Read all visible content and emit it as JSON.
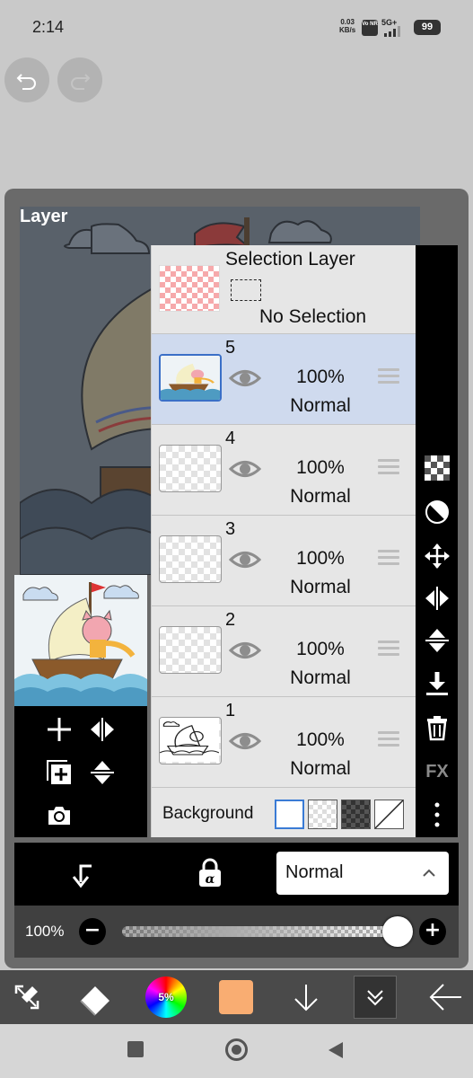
{
  "status_bar": {
    "time": "2:14",
    "net_speed_value": "0.03",
    "net_speed_unit": "KB/s",
    "volte": "Vo NR",
    "signal": "5G+",
    "battery": "99"
  },
  "panel": {
    "title": "Layer"
  },
  "selection_layer": {
    "title": "Selection Layer",
    "status": "No Selection"
  },
  "layers": [
    {
      "number": "5",
      "opacity": "100%",
      "blend": "Normal",
      "selected": true
    },
    {
      "number": "4",
      "opacity": "100%",
      "blend": "Normal",
      "selected": false
    },
    {
      "number": "3",
      "opacity": "100%",
      "blend": "Normal",
      "selected": false
    },
    {
      "number": "2",
      "opacity": "100%",
      "blend": "Normal",
      "selected": false
    },
    {
      "number": "1",
      "opacity": "100%",
      "blend": "Normal",
      "selected": false
    }
  ],
  "background": {
    "label": "Background"
  },
  "right_toolbar": {
    "fx_label": "FX"
  },
  "blend_bar": {
    "blend_mode": "Normal"
  },
  "opacity_bar": {
    "label": "100%",
    "value": 1.0
  },
  "app_toolbar": {
    "color_wheel_label": "5%",
    "current_color": "#f9ad72"
  },
  "colors": {
    "selected_layer_bg": "#cfdaee",
    "selected_thumb_border": "#3a6fc7",
    "panel_bg": "#6a6a6a"
  }
}
